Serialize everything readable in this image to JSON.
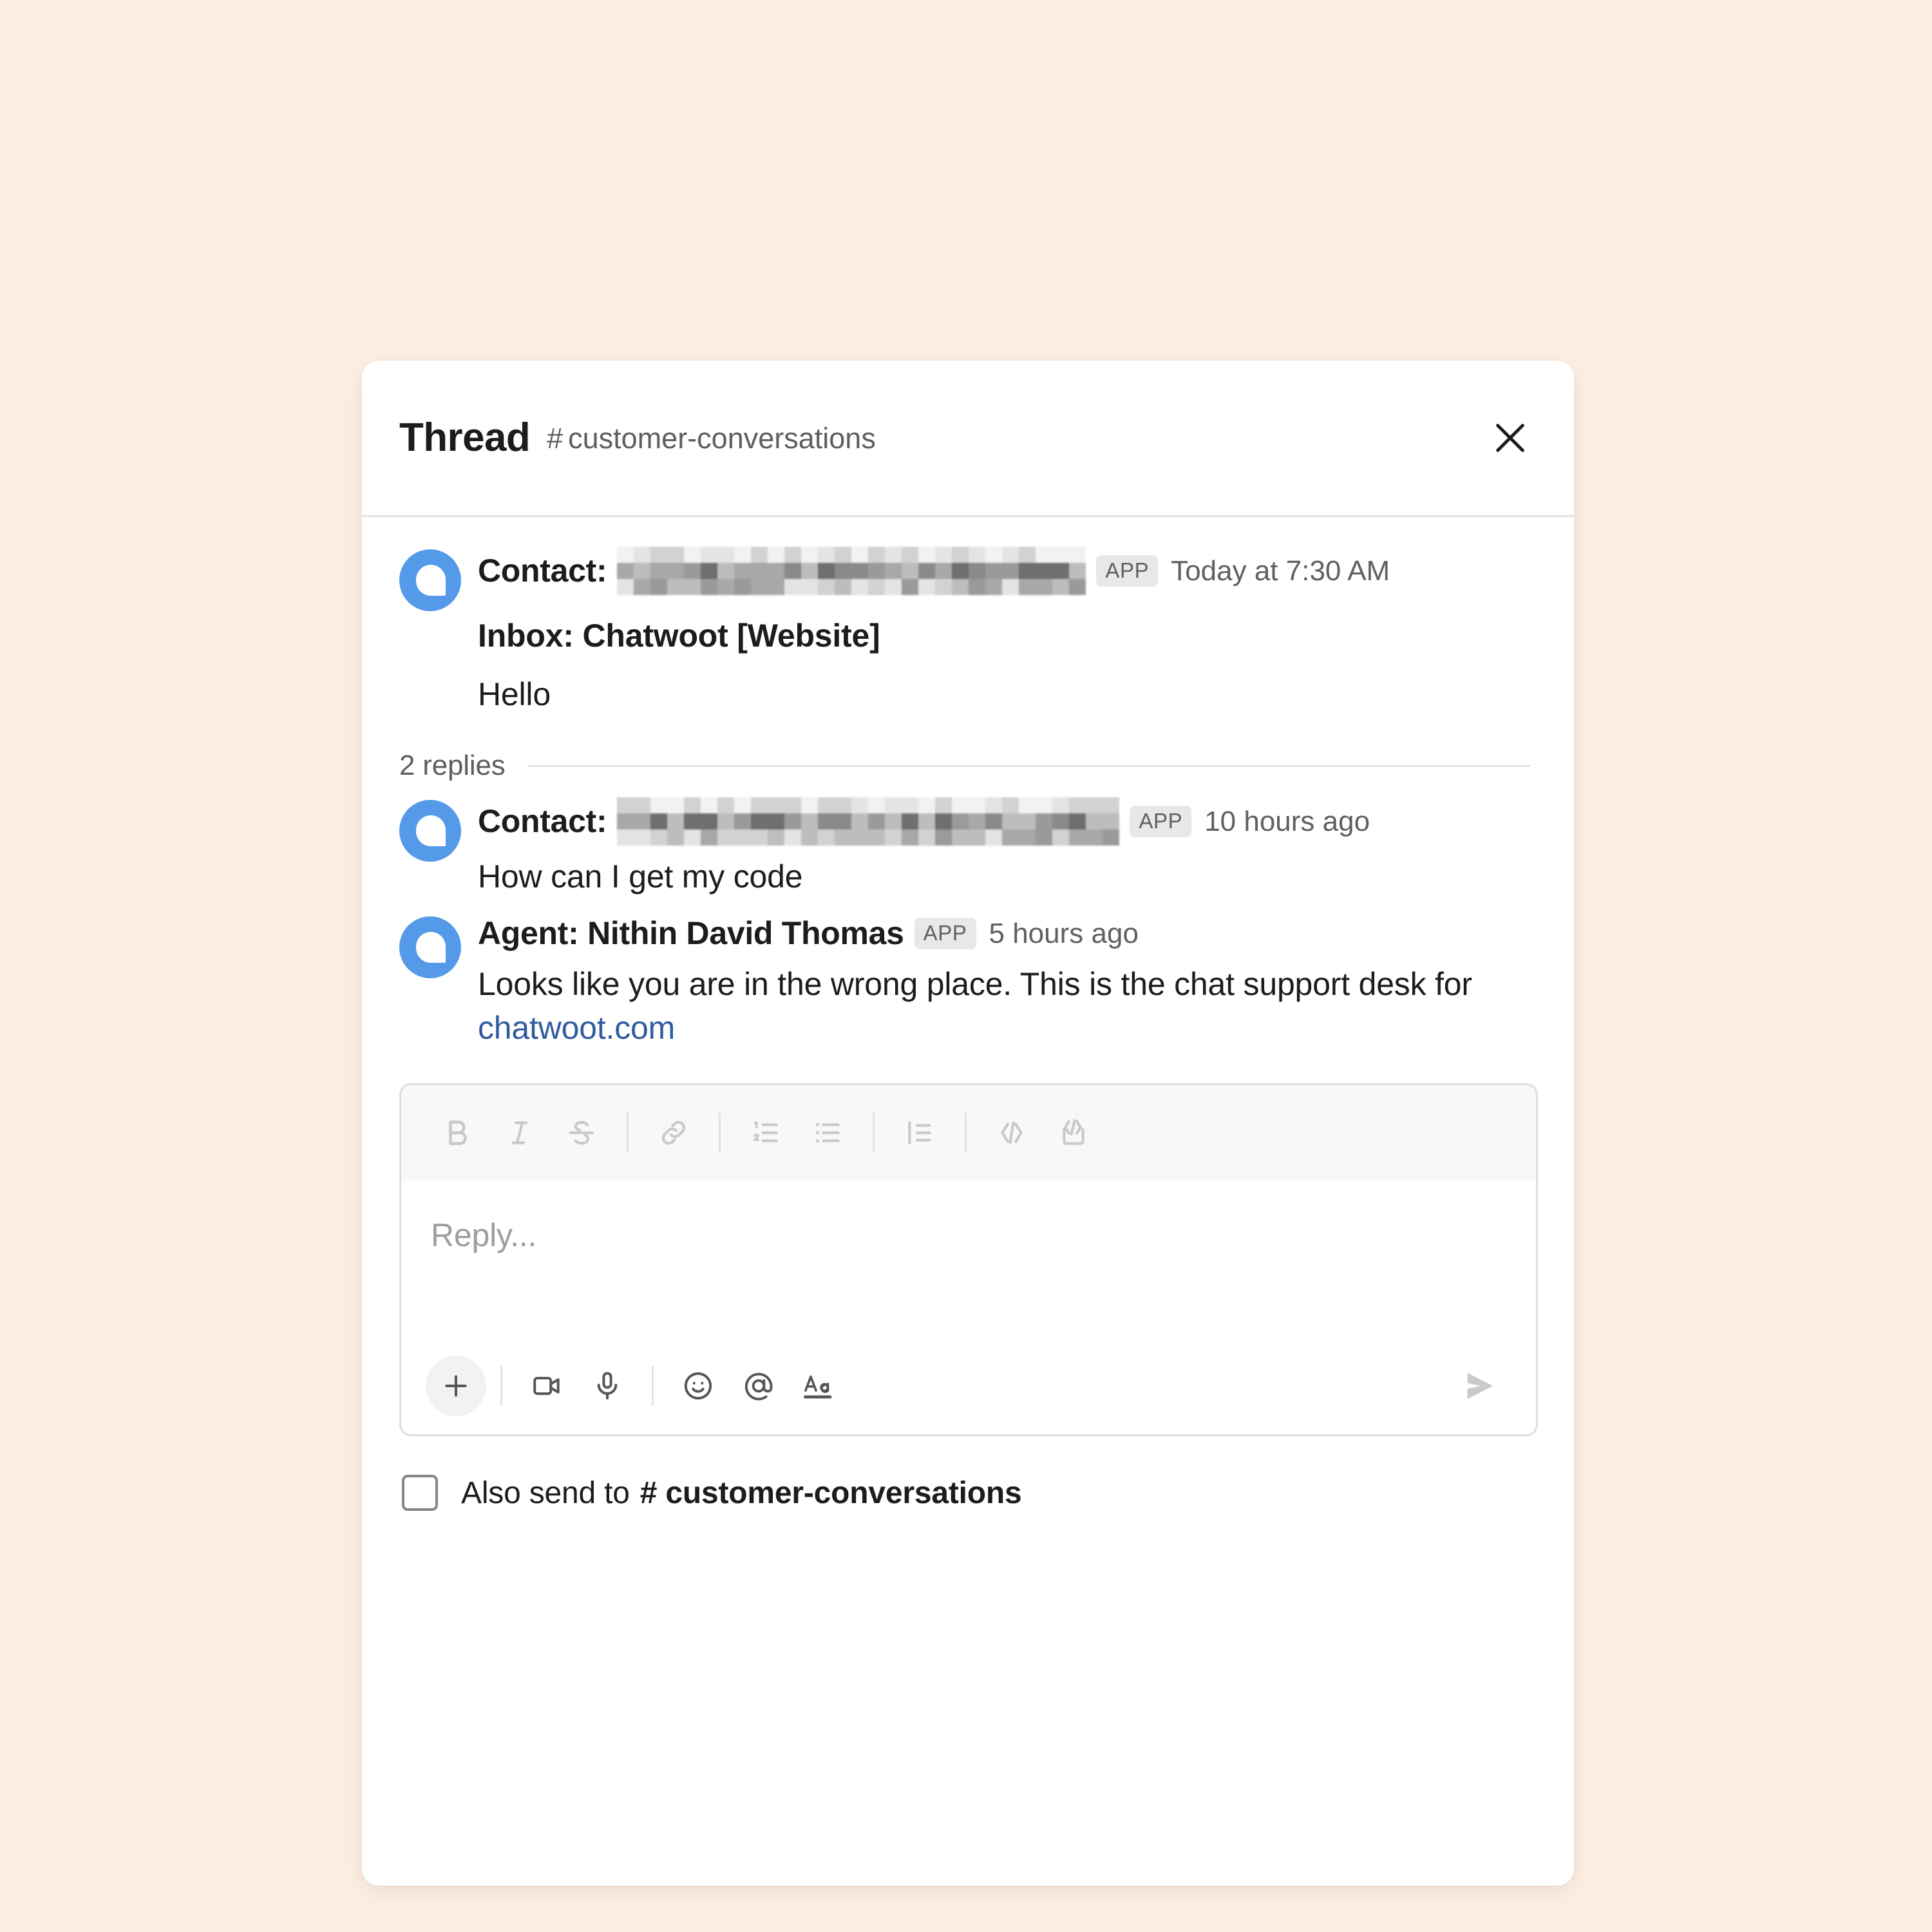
{
  "theme": {
    "page_background": "#fdeee2",
    "card_background": "#ffffff",
    "accent_avatar": "#549ae8",
    "link_color": "#2f5b9e",
    "badge_background": "#e8e8e8",
    "text_primary": "#1d1c1d",
    "text_secondary": "#616061"
  },
  "header": {
    "title": "Thread",
    "channel_hash": "#",
    "channel_name": "customer-conversations",
    "close_icon": "close-icon"
  },
  "messages": {
    "root": {
      "sender_label": "Contact:",
      "sender_name_redacted": true,
      "badge": "APP",
      "timestamp": "Today at 7:30 AM",
      "subject": "Inbox: Chatwoot [Website]",
      "text": "Hello",
      "avatar_icon": "chatwoot-logo-avatar"
    },
    "replies_divider": {
      "count_label": "2 replies"
    },
    "replies": [
      {
        "sender_label": "Contact:",
        "sender_name_redacted": true,
        "badge": "APP",
        "timestamp": "10 hours ago",
        "text": "How can I get my code",
        "avatar_icon": "chatwoot-logo-avatar"
      },
      {
        "sender_label": "Agent: Nithin David Thomas",
        "sender_name_redacted": false,
        "badge": "APP",
        "timestamp": "5 hours ago",
        "text_before_link": "Looks like you are in the wrong place. This is the chat support desk for ",
        "link_text": "chatwoot.com",
        "avatar_icon": "chatwoot-logo-avatar"
      }
    ]
  },
  "composer": {
    "placeholder": "Reply...",
    "value": "",
    "toolbar": [
      {
        "name": "bold-icon",
        "label": "B"
      },
      {
        "name": "italic-icon",
        "label": "I"
      },
      {
        "name": "strikethrough-icon",
        "label": "S"
      },
      {
        "name": "link-icon",
        "label": "Link"
      },
      {
        "name": "ordered-list-icon",
        "label": "Ordered list"
      },
      {
        "name": "bulleted-list-icon",
        "label": "Bulleted list"
      },
      {
        "name": "blockquote-icon",
        "label": "Blockquote"
      },
      {
        "name": "code-icon",
        "label": "Code"
      },
      {
        "name": "code-block-icon",
        "label": "Code block"
      }
    ],
    "actions": [
      {
        "name": "plus-icon",
        "label": "Add shortcut or file"
      },
      {
        "name": "video-icon",
        "label": "Record video clip"
      },
      {
        "name": "microphone-icon",
        "label": "Record audio clip"
      },
      {
        "name": "emoji-icon",
        "label": "Emoji"
      },
      {
        "name": "mention-icon",
        "label": "Mention someone"
      },
      {
        "name": "formatting-icon",
        "label": "Aa"
      },
      {
        "name": "send-icon",
        "label": "Send"
      }
    ]
  },
  "also_send": {
    "checked": false,
    "label": "Also send to",
    "channel_hash": "#",
    "channel_name": "customer-conversations"
  }
}
